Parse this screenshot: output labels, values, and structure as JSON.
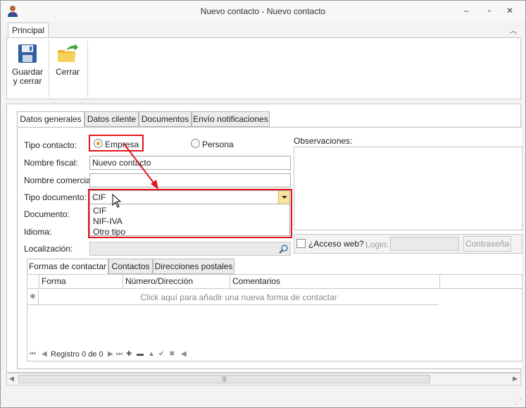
{
  "window": {
    "title": "Nuevo contacto - Nuevo contacto",
    "minimize": "–",
    "restore": "▫",
    "close": "✕"
  },
  "ribbon": {
    "tab_label": "Principal",
    "collapse_icon": "chevron-up-icon",
    "save_label_line1": "Guardar",
    "save_label_line2": "y cerrar",
    "close_label": "Cerrar"
  },
  "tabs": [
    "Datos generales",
    "Datos cliente",
    "Documentos",
    "Envío notificaciones"
  ],
  "form": {
    "tipo_contacto_label": "Tipo contacto:",
    "empresa_label": "Empresa",
    "persona_label": "Persona",
    "nombre_fiscal_label": "Nombre fiscal:",
    "nombre_fiscal_value": "Nuevo contacto",
    "nombre_comercial_label": "Nombre comercial:",
    "nombre_comercial_value": "",
    "tipo_documento_label": "Tipo documento:",
    "tipo_documento_value": "CIF",
    "tipo_documento_options": [
      "CIF",
      "NIF-IVA",
      "Otro tipo"
    ],
    "documento_label": "Documento:",
    "idioma_label": "Idioma:",
    "localizacion_label": "Localización:",
    "observaciones_label": "Observaciones:",
    "acceso_web_label": "¿Acceso web?",
    "login_label": "Login:",
    "contrasena_label": "Contraseña"
  },
  "subtabs": [
    "Formas de contactar",
    "Contactos",
    "Direcciones postales"
  ],
  "grid": {
    "columns": [
      "Forma",
      "Número/Dirección",
      "Comentarios"
    ],
    "new_row_text": "Click aquí para añadir una nueva forma de contactar",
    "record_text": "Registro 0 de 0"
  },
  "colors": {
    "highlight": "#e0161d",
    "accent": "#e6a23c"
  }
}
